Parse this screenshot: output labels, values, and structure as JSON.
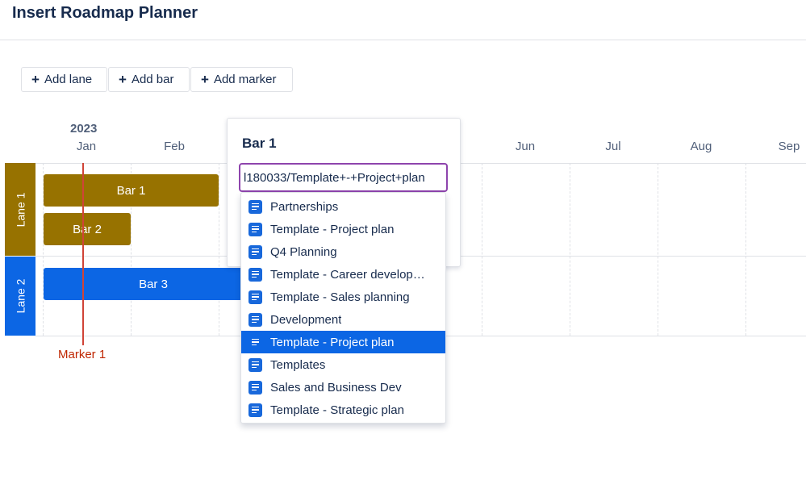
{
  "page": {
    "title": "Insert Roadmap Planner"
  },
  "toolbar": {
    "add_lane": "Add lane",
    "add_bar": "Add bar",
    "add_marker": "Add marker",
    "icon": "plus-icon"
  },
  "timeline": {
    "year": "2023",
    "months": [
      "Jan",
      "Feb",
      "Jun",
      "Jul",
      "Aug",
      "Sep"
    ]
  },
  "lanes": [
    {
      "label": "Lane 1",
      "color": "#977200"
    },
    {
      "label": "Lane 2",
      "color": "#0c66e4"
    }
  ],
  "bars": [
    {
      "label": "Bar 1",
      "color": "#977200"
    },
    {
      "label": "Bar 2",
      "color": "#977200"
    },
    {
      "label": "Bar 3",
      "color": "#0c66e4"
    }
  ],
  "marker": {
    "label": "Marker 1",
    "color": "#d04437"
  },
  "bar_editor": {
    "title": "Bar 1",
    "link_value": "l180033/Template+-+Project+plan",
    "suggestions": [
      {
        "label": "Partnerships"
      },
      {
        "label": "Template - Project plan"
      },
      {
        "label": "Q4 Planning"
      },
      {
        "label": "Template - Career develop…"
      },
      {
        "label": "Template - Sales planning"
      },
      {
        "label": "Development"
      },
      {
        "label": "Template - Project plan",
        "selected": true
      },
      {
        "label": "Templates"
      },
      {
        "label": "Sales and Business Dev"
      },
      {
        "label": "Template - Strategic plan"
      }
    ],
    "icon": "page-icon"
  }
}
